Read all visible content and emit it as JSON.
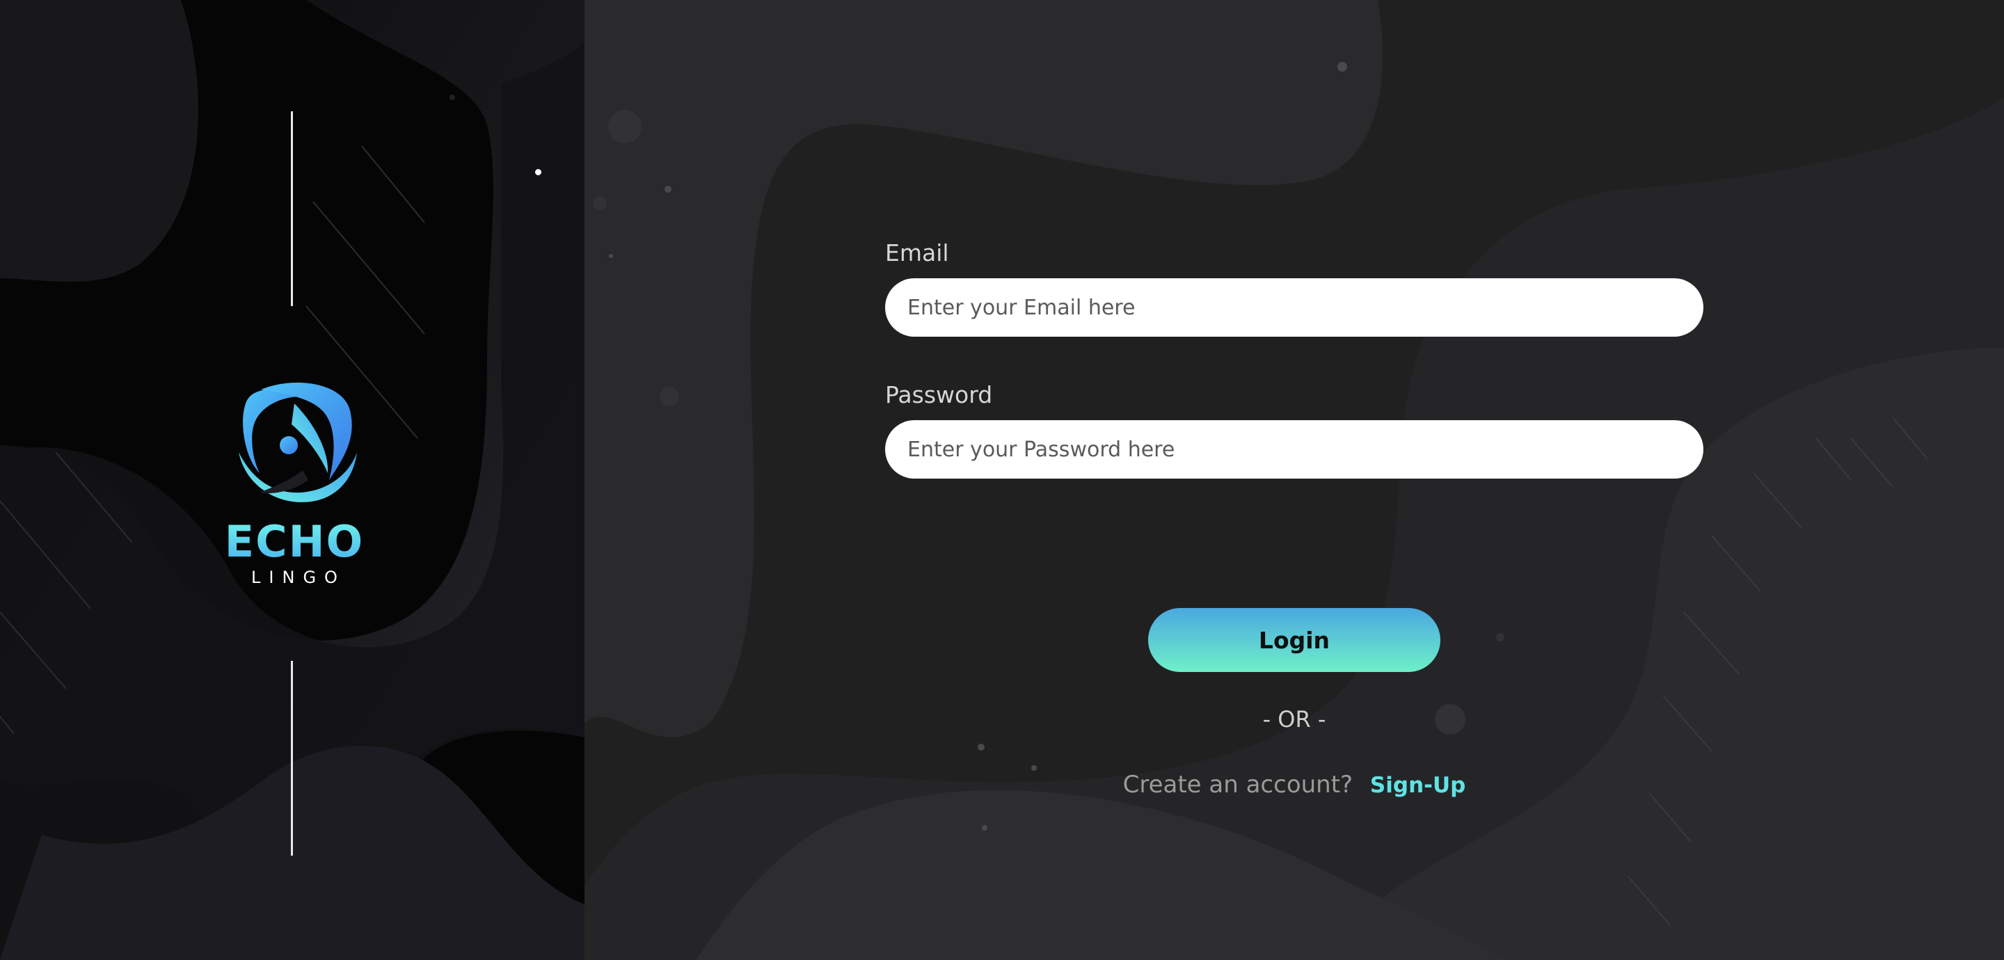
{
  "brand": {
    "name": "ECHO",
    "tagline": "LINGO",
    "icon": "echo-lingo-logo-icon",
    "accent_color": "#5ee3e6"
  },
  "form": {
    "email": {
      "label": "Email",
      "placeholder": "Enter your Email here",
      "value": ""
    },
    "password": {
      "label": "Password",
      "placeholder": "Enter your Password here",
      "value": ""
    },
    "login_label": "Login",
    "or_label": "- OR -",
    "signup_prompt": "Create an account?",
    "signup_link": "Sign-Up"
  },
  "colors": {
    "background": "#202021",
    "left_panel": "#000000",
    "button_gradient_top": "#4aa8e0",
    "button_gradient_bottom": "#6ff0c8",
    "link": "#5ee3e6"
  }
}
